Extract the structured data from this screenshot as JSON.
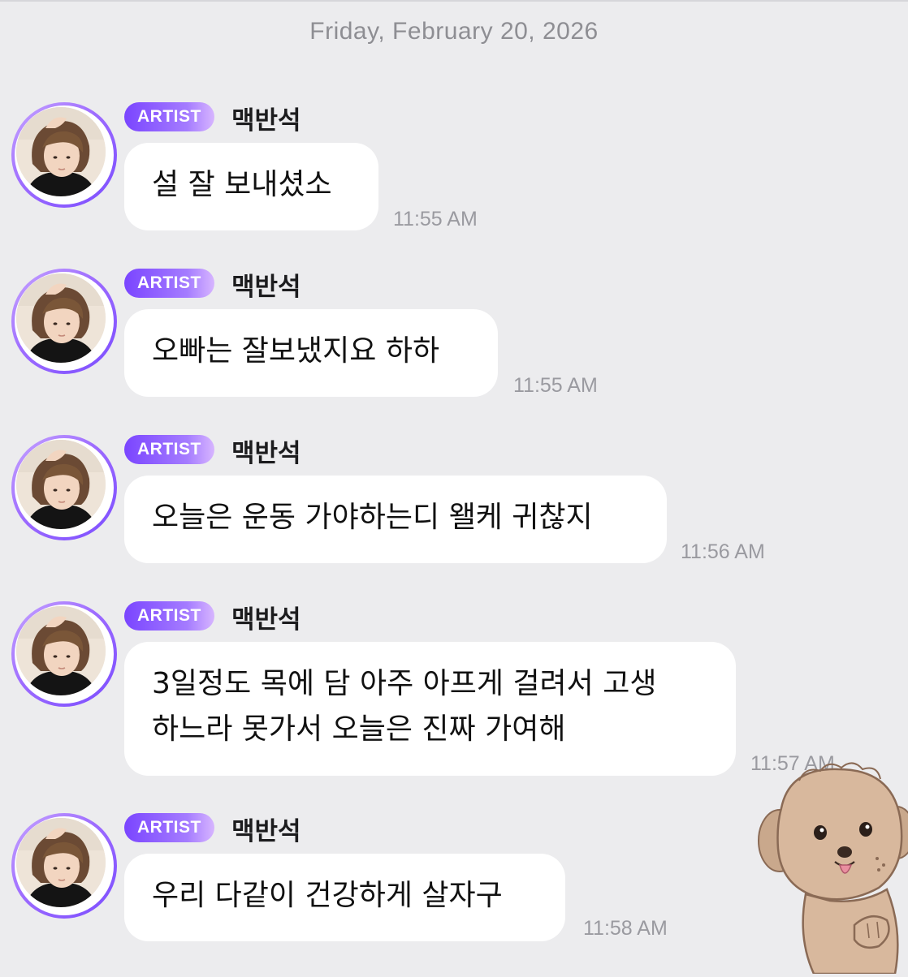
{
  "date_header": "Friday, February 20, 2026",
  "messages": [
    {
      "badge": "ARTIST",
      "sender": "맥반석",
      "lines": [
        "설 잘 보내셨소"
      ],
      "time": "11:55 AM"
    },
    {
      "badge": "ARTIST",
      "sender": "맥반석",
      "lines": [
        "오빠는 잘보냈지요 하하"
      ],
      "time": "11:55 AM"
    },
    {
      "badge": "ARTIST",
      "sender": "맥반석",
      "lines": [
        "오늘은 운동 가야하는디 왤케 귀찮지"
      ],
      "time": "11:56 AM"
    },
    {
      "badge": "ARTIST",
      "sender": "맥반석",
      "lines": [
        "3일정도 목에 담 아주 아프게 걸려서 고생",
        "하느라 못가서 오늘은 진짜 가여해"
      ],
      "time": "11:57 AM"
    },
    {
      "badge": "ARTIST",
      "sender": "맥반석",
      "lines": [
        "우리 다같이 건강하게 살자구"
      ],
      "time": "11:58 AM"
    }
  ],
  "icons": {
    "avatar": "artist-profile-photo",
    "sticker": "brown-puppy-sticker"
  },
  "colors": {
    "background": "#ececee",
    "bubble": "#ffffff",
    "badge_start": "#7a45ff",
    "badge_end": "#d7b5ff",
    "avatar_ring": "#9d6bff",
    "timestamp": "#9a9aa0"
  }
}
